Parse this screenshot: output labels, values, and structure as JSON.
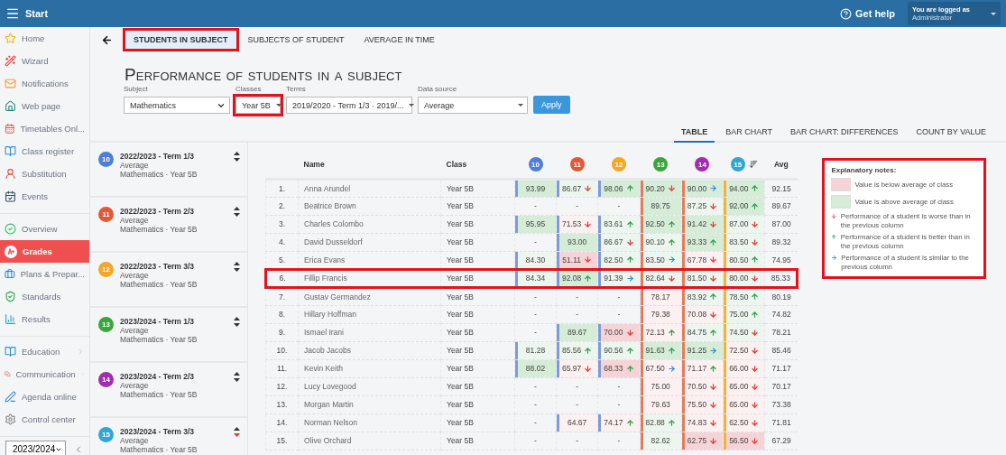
{
  "topbar": {
    "title": "Start",
    "help": "Get help",
    "user_caption": "You are logged as",
    "user_name": "Administrator"
  },
  "sidebar": {
    "groups": [
      [
        {
          "label": "Home",
          "selected": false,
          "has_submenu": false
        },
        {
          "label": "Wizard",
          "selected": false,
          "has_submenu": false
        },
        {
          "label": "Notifications",
          "selected": false,
          "has_submenu": false
        },
        {
          "label": "Web page",
          "selected": false,
          "has_submenu": false
        },
        {
          "label": "Timetables Onl...",
          "selected": false,
          "has_submenu": false
        },
        {
          "label": "Class register",
          "selected": false,
          "has_submenu": false
        },
        {
          "label": "Substitution",
          "selected": false,
          "has_submenu": false
        },
        {
          "label": "Events",
          "selected": false,
          "has_submenu": false
        }
      ],
      [
        {
          "label": "Overview",
          "selected": false,
          "has_submenu": false
        },
        {
          "label": "Grades",
          "selected": true,
          "has_submenu": false
        },
        {
          "label": "Plans & Prepar...",
          "selected": false,
          "has_submenu": false
        },
        {
          "label": "Standards",
          "selected": false,
          "has_submenu": false
        },
        {
          "label": "Results",
          "selected": false,
          "has_submenu": false
        }
      ],
      [
        {
          "label": "Education",
          "selected": false,
          "has_submenu": true
        },
        {
          "label": "Communication",
          "selected": false,
          "has_submenu": true
        },
        {
          "label": "Agenda online",
          "selected": false,
          "has_submenu": false
        },
        {
          "label": "Control center",
          "selected": false,
          "has_submenu": false
        }
      ]
    ],
    "year": "2023/2024"
  },
  "nav_tabs": [
    {
      "label": "STUDENTS IN SUBJECT",
      "selected": true,
      "highlighted": true
    },
    {
      "label": "SUBJECTS OF STUDENT",
      "selected": false,
      "highlighted": false
    },
    {
      "label": "AVERAGE IN TIME",
      "selected": false,
      "highlighted": false
    }
  ],
  "page_title": "Performance of students in a subject",
  "filters": [
    {
      "label": "Subject",
      "value": "Mathematics",
      "kind": "native",
      "highlighted": false
    },
    {
      "label": "Classes",
      "value": "Year 5B",
      "kind": "caret",
      "highlighted": true
    },
    {
      "label": "Terms",
      "value": "2019/2020 - Term 1/3 · 2019/...",
      "kind": "caret",
      "highlighted": false
    },
    {
      "label": "Data source",
      "value": "Average",
      "kind": "caret",
      "highlighted": false
    }
  ],
  "apply_button": "Apply",
  "view_tabs": [
    {
      "label": "TABLE",
      "selected": true
    },
    {
      "label": "BAR CHART",
      "selected": false
    },
    {
      "label": "BAR CHART: DIFFERENCES",
      "selected": false
    },
    {
      "label": "COUNT BY VALUE",
      "selected": false
    }
  ],
  "terms": [
    {
      "badge": "10",
      "color": "#4f7fd6",
      "title": "2022/2023 - Term 1/3",
      "source": "Average",
      "subject": "Mathematics · Year 5B",
      "sorted": false
    },
    {
      "badge": "11",
      "color": "#e0583a",
      "title": "2022/2023 - Term 2/3",
      "source": "Average",
      "subject": "Mathematics · Year 5B",
      "sorted": false
    },
    {
      "badge": "12",
      "color": "#f6a623",
      "title": "2022/2023 - Term 3/3",
      "source": "Average",
      "subject": "Mathematics · Year 5B",
      "sorted": false
    },
    {
      "badge": "13",
      "color": "#3aa53f",
      "title": "2023/2024 - Term 1/3",
      "source": "Average",
      "subject": "Mathematics · Year 5B",
      "sorted": false
    },
    {
      "badge": "14",
      "color": "#a22db0",
      "title": "2023/2024 - Term 2/3",
      "source": "Average",
      "subject": "Mathematics · Year 5B",
      "sorted": false
    },
    {
      "badge": "15",
      "color": "#2ea8d2",
      "title": "2023/2024 - Term 3/3",
      "source": "Average",
      "subject": "Mathematics · Year 5B",
      "sorted": true
    }
  ],
  "table": {
    "name_header": "Name",
    "class_header": "Class",
    "avg_header": "Avg",
    "columns": [
      {
        "label": "10",
        "color": "#4f7fd6",
        "marker": {
          "color": "#7d9bdc"
        },
        "sorted": false
      },
      {
        "label": "11",
        "color": "#e0583a",
        "marker": {
          "color": "#7d9bdc"
        },
        "sorted": false
      },
      {
        "label": "12",
        "color": "#f6a623",
        "marker": {
          "color": "#7d9bdc"
        },
        "sorted": false
      },
      {
        "label": "13",
        "color": "#3aa53f",
        "marker": {
          "color": "#e47a5e"
        },
        "sorted": false
      },
      {
        "label": "14",
        "color": "#a22db0",
        "marker": {
          "color": "#e47a5e"
        },
        "sorted": false
      },
      {
        "label": "15",
        "color": "#2ea8d2",
        "marker": {
          "color": "#f3b13c"
        },
        "sorted": true
      }
    ],
    "rows": [
      {
        "no": "1.",
        "name": "Anna Arundel",
        "class": "Year 5B",
        "avg": "92.15",
        "highlighted": false,
        "cells": [
          {
            "value": "93.99",
            "color": "#d5ecd7",
            "kind": "none"
          },
          {
            "value": "86.67",
            "color": "#edf6ee",
            "kind": "down"
          },
          {
            "value": "98.06",
            "color": "#d5ecd7",
            "kind": "up"
          },
          {
            "value": "90.20",
            "color": "#d5ecd7",
            "kind": "down"
          },
          {
            "value": "90.00",
            "color": "#d5ecd7",
            "kind": "same"
          },
          {
            "value": "94.00",
            "color": "#d5ecd7",
            "kind": "up"
          }
        ]
      },
      {
        "no": "2.",
        "name": "Beatrice Brown",
        "class": "Year 5B",
        "avg": "89.67",
        "highlighted": false,
        "cells": [
          {
            "value": "-",
            "kind": "none"
          },
          {
            "value": "-",
            "kind": "none"
          },
          {
            "value": "-",
            "kind": "none"
          },
          {
            "value": "89.75",
            "color": "#d5ecd7",
            "kind": "none"
          },
          {
            "value": "87.25",
            "color": "#edf6ee",
            "kind": "down"
          },
          {
            "value": "92.00",
            "color": "#d5ecd7",
            "kind": "up"
          }
        ]
      },
      {
        "no": "3.",
        "name": "Charles Colombo",
        "class": "Year 5B",
        "avg": "87.00",
        "highlighted": false,
        "cells": [
          {
            "value": "95.95",
            "color": "#d5ecd7",
            "kind": "none"
          },
          {
            "value": "71.53",
            "color": "#fcf0f0",
            "kind": "down"
          },
          {
            "value": "83.61",
            "color": "#edf6ee",
            "kind": "up"
          },
          {
            "value": "92.50",
            "color": "#d5ecd7",
            "kind": "up"
          },
          {
            "value": "91.42",
            "color": "#d5ecd7",
            "kind": "down"
          },
          {
            "value": "87.00",
            "color": "#edf6ee",
            "kind": "down"
          }
        ]
      },
      {
        "no": "4.",
        "name": "David Dusseldorf",
        "class": "Year 5B",
        "avg": "89.32",
        "highlighted": false,
        "cells": [
          {
            "value": "-",
            "kind": "none"
          },
          {
            "value": "93.00",
            "color": "#d5ecd7",
            "kind": "none"
          },
          {
            "value": "86.67",
            "color": "#edf6ee",
            "kind": "down"
          },
          {
            "value": "90.10",
            "color": "#edf6ee",
            "kind": "up"
          },
          {
            "value": "93.33",
            "color": "#d5ecd7",
            "kind": "up"
          },
          {
            "value": "83.50",
            "color": "#edf6ee",
            "kind": "down"
          }
        ]
      },
      {
        "no": "5.",
        "name": "Erica Evans",
        "class": "Year 5B",
        "avg": "74.95",
        "highlighted": false,
        "cells": [
          {
            "value": "84.30",
            "color": "#edf6ee",
            "kind": "none"
          },
          {
            "value": "51.11",
            "color": "#f6d3d6",
            "kind": "down"
          },
          {
            "value": "82.50",
            "color": "#edf6ee",
            "kind": "up"
          },
          {
            "value": "83.50",
            "color": "#edf6ee",
            "kind": "same"
          },
          {
            "value": "67.78",
            "color": "#fcf0f0",
            "kind": "down"
          },
          {
            "value": "80.50",
            "color": "#edf6ee",
            "kind": "up"
          }
        ]
      },
      {
        "no": "6.",
        "name": "Fillip Francis",
        "class": "Year 5B",
        "avg": "85.33",
        "highlighted": true,
        "cells": [
          {
            "value": "84.34",
            "color": "#edf6ee",
            "kind": "none"
          },
          {
            "value": "92.08",
            "color": "#d5ecd7",
            "kind": "up"
          },
          {
            "value": "91.39",
            "color": "#edf6ee",
            "kind": "same"
          },
          {
            "value": "82.64",
            "color": "#edf6ee",
            "kind": "down"
          },
          {
            "value": "81.50",
            "color": "#edf6ee",
            "kind": "down"
          },
          {
            "value": "80.00",
            "color": "#edf6ee",
            "kind": "down"
          }
        ]
      },
      {
        "no": "7.",
        "name": "Gustav Germandez",
        "class": "Year 5B",
        "avg": "80.19",
        "highlighted": false,
        "cells": [
          {
            "value": "-",
            "kind": "none"
          },
          {
            "value": "-",
            "kind": "none"
          },
          {
            "value": "-",
            "kind": "none"
          },
          {
            "value": "78.17",
            "color": "#fcf0f0",
            "kind": "none"
          },
          {
            "value": "83.92",
            "color": "#edf6ee",
            "kind": "up"
          },
          {
            "value": "78.50",
            "color": "#edf6ee",
            "kind": "up"
          }
        ]
      },
      {
        "no": "8.",
        "name": "Hillary Hoffman",
        "class": "Year 5B",
        "avg": "74.82",
        "highlighted": false,
        "cells": [
          {
            "value": "-",
            "kind": "none"
          },
          {
            "value": "-",
            "kind": "none"
          },
          {
            "value": "-",
            "kind": "none"
          },
          {
            "value": "79.38",
            "color": "#fcf0f0",
            "kind": "none"
          },
          {
            "value": "70.08",
            "color": "#fcf0f0",
            "kind": "down"
          },
          {
            "value": "75.00",
            "color": "#edf6ee",
            "kind": "up"
          }
        ]
      },
      {
        "no": "9.",
        "name": "Ismael Irani",
        "class": "Year 5B",
        "avg": "78.21",
        "highlighted": false,
        "cells": [
          {
            "value": "-",
            "kind": "none"
          },
          {
            "value": "89.67",
            "color": "#d5ecd7",
            "kind": "none"
          },
          {
            "value": "70.00",
            "color": "#f6d3d6",
            "kind": "down"
          },
          {
            "value": "72.13",
            "color": "#fcf0f0",
            "kind": "up"
          },
          {
            "value": "84.75",
            "color": "#edf6ee",
            "kind": "up"
          },
          {
            "value": "74.50",
            "color": "#edf6ee",
            "kind": "down"
          }
        ]
      },
      {
        "no": "10.",
        "name": "Jacob Jacobs",
        "class": "Year 5B",
        "avg": "85.46",
        "highlighted": false,
        "cells": [
          {
            "value": "81.28",
            "color": "#edf6ee",
            "kind": "none"
          },
          {
            "value": "85.56",
            "color": "#edf6ee",
            "kind": "up"
          },
          {
            "value": "90.56",
            "color": "#edf6ee",
            "kind": "up"
          },
          {
            "value": "91.63",
            "color": "#d5ecd7",
            "kind": "up"
          },
          {
            "value": "91.25",
            "color": "#d5ecd7",
            "kind": "same"
          },
          {
            "value": "72.50",
            "color": "#fcf0f0",
            "kind": "down"
          }
        ]
      },
      {
        "no": "11.",
        "name": "Kevin Keith",
        "class": "Year 5B",
        "avg": "71.17",
        "highlighted": false,
        "cells": [
          {
            "value": "88.02",
            "color": "#d5ecd7",
            "kind": "none"
          },
          {
            "value": "65.97",
            "color": "#fcf0f0",
            "kind": "down"
          },
          {
            "value": "68.33",
            "color": "#f6d3d6",
            "kind": "up"
          },
          {
            "value": "67.50",
            "color": "#fcf0f0",
            "kind": "same"
          },
          {
            "value": "71.17",
            "color": "#fcf0f0",
            "kind": "up"
          },
          {
            "value": "66.00",
            "color": "#fcf0f0",
            "kind": "down"
          }
        ]
      },
      {
        "no": "12.",
        "name": "Lucy Lovegood",
        "class": "Year 5B",
        "avg": "70.17",
        "highlighted": false,
        "cells": [
          {
            "value": "-",
            "kind": "none"
          },
          {
            "value": "-",
            "kind": "none"
          },
          {
            "value": "-",
            "kind": "none"
          },
          {
            "value": "75.00",
            "color": "#fcf0f0",
            "kind": "none"
          },
          {
            "value": "70.50",
            "color": "#fcf0f0",
            "kind": "down"
          },
          {
            "value": "65.00",
            "color": "#fcf0f0",
            "kind": "down"
          }
        ]
      },
      {
        "no": "13.",
        "name": "Morgan Martin",
        "class": "Year 5B",
        "avg": "73.38",
        "highlighted": false,
        "cells": [
          {
            "value": "-",
            "kind": "none"
          },
          {
            "value": "-",
            "kind": "none"
          },
          {
            "value": "-",
            "kind": "none"
          },
          {
            "value": "79.63",
            "color": "#fcf0f0",
            "kind": "none"
          },
          {
            "value": "75.50",
            "color": "#fcf0f0",
            "kind": "down"
          },
          {
            "value": "65.00",
            "color": "#fcf0f0",
            "kind": "down"
          }
        ]
      },
      {
        "no": "14.",
        "name": "Norman Nelson",
        "class": "Year 5B",
        "avg": "71.81",
        "highlighted": false,
        "cells": [
          {
            "value": "-",
            "kind": "none"
          },
          {
            "value": "64.67",
            "color": "#fcf0f0",
            "kind": "none"
          },
          {
            "value": "74.17",
            "color": "#fcf0f0",
            "kind": "up"
          },
          {
            "value": "82.88",
            "color": "#edf6ee",
            "kind": "up"
          },
          {
            "value": "74.83",
            "color": "#fcf0f0",
            "kind": "down"
          },
          {
            "value": "62.50",
            "color": "#fcf0f0",
            "kind": "down"
          }
        ]
      },
      {
        "no": "15.",
        "name": "Olive Orchard",
        "class": "Year 5B",
        "avg": "67.29",
        "highlighted": false,
        "cells": [
          {
            "value": "-",
            "kind": "none"
          },
          {
            "value": "-",
            "kind": "none"
          },
          {
            "value": "-",
            "kind": "none"
          },
          {
            "value": "82.62",
            "color": "#edf6ee",
            "kind": "none"
          },
          {
            "value": "62.75",
            "color": "#f6d3d6",
            "kind": "down"
          },
          {
            "value": "56.50",
            "color": "#f6d3d6",
            "kind": "down"
          }
        ]
      }
    ]
  },
  "legend": {
    "title": "Explanatory notes:",
    "highlighted": true,
    "items": [
      {
        "kind": "swatch",
        "color": "#f6d3d6",
        "text": "Value is below average of class"
      },
      {
        "kind": "swatch",
        "color": "#d5ecd7",
        "text": "Value is above average of class"
      },
      {
        "kind": "down",
        "text": "Performance of a student is worse than in the previous column"
      },
      {
        "kind": "up",
        "text": "Performance of a student is better than in the previous column"
      },
      {
        "kind": "same",
        "text": "Performance of a student is similar to the previous column"
      }
    ]
  }
}
